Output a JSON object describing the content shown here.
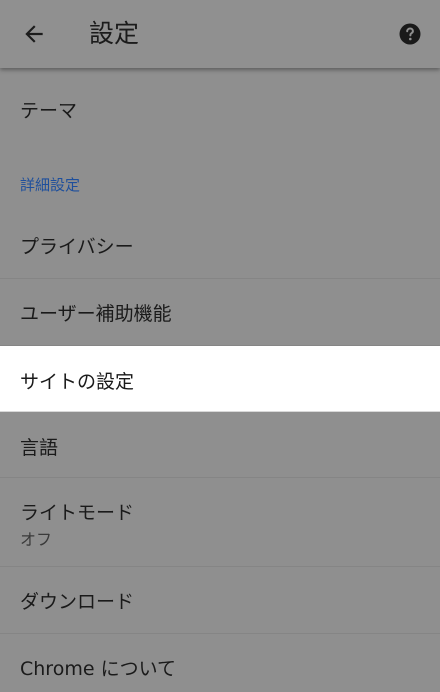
{
  "toolbar": {
    "back_icon": "arrow-left-icon",
    "title": "設定",
    "help_icon": "help-circle-icon"
  },
  "items": {
    "theme": {
      "label": "テーマ"
    },
    "advanced_header": {
      "label": "詳細設定"
    },
    "privacy": {
      "label": "プライバシー"
    },
    "accessibility": {
      "label": "ユーザー補助機能"
    },
    "site_settings": {
      "label": "サイトの設定"
    },
    "languages": {
      "label": "言語"
    },
    "lite_mode": {
      "label": "ライトモード",
      "summary": "オフ"
    },
    "downloads": {
      "label": "ダウンロード"
    },
    "about_chrome": {
      "label": "Chrome について"
    }
  },
  "colors": {
    "scrim": "#8f8f8f",
    "highlight": "#ffffff",
    "section_header": "#1e4f9c"
  }
}
